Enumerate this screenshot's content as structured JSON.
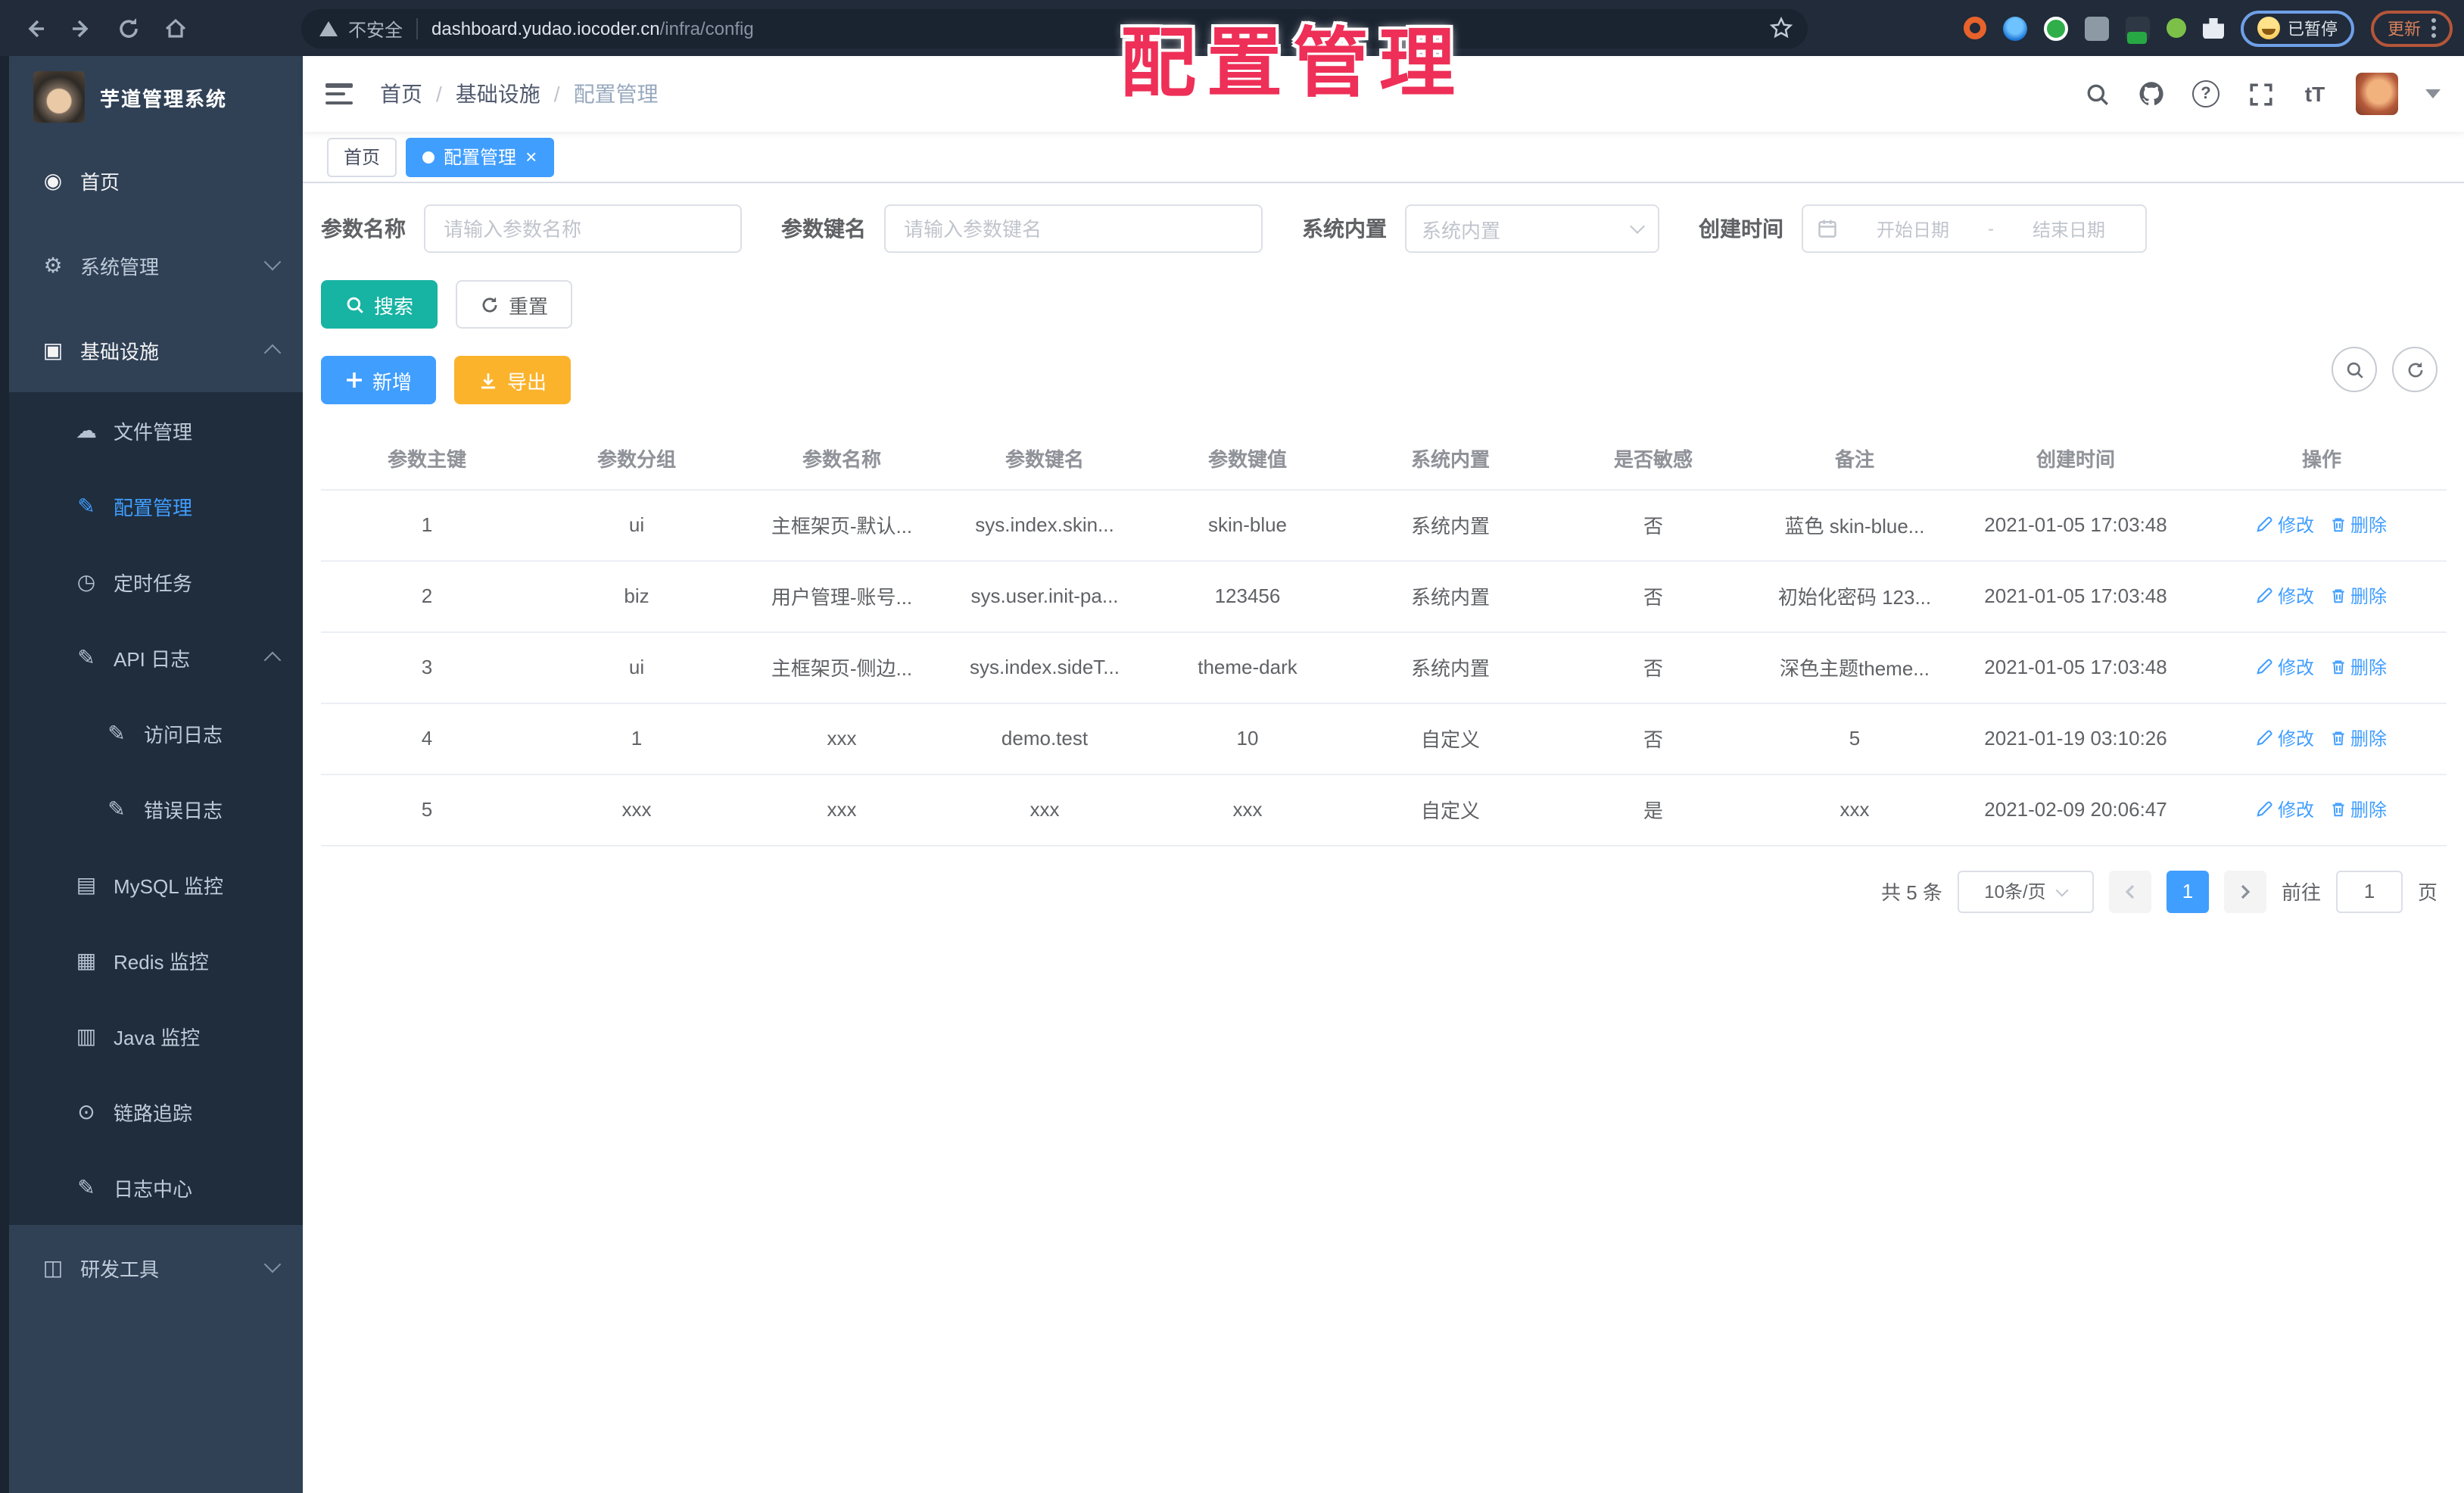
{
  "colors": {
    "accent": "#409eff",
    "search_btn": "#17b3a3",
    "export_btn": "#fbb32c",
    "annotation": "#ee2f57",
    "sidebar_bg": "#304156",
    "submenu_bg": "#1f2d3d"
  },
  "annotation": {
    "text": "配置管理"
  },
  "browser": {
    "security_label": "不安全",
    "url_host": "dashboard.yudao.iocoder.cn",
    "url_path": "/infra/config",
    "paused_label": "已暂停",
    "update_label": "更新"
  },
  "sidebar": {
    "app_title": "芋道管理系统",
    "items": [
      {
        "icon": "◉",
        "label": "首页"
      },
      {
        "icon": "⚙",
        "label": "系统管理"
      },
      {
        "icon": "▣",
        "label": "基础设施"
      },
      {
        "icon": "☁",
        "label": "文件管理"
      },
      {
        "icon": "✎",
        "label": "配置管理"
      },
      {
        "icon": "◷",
        "label": "定时任务"
      },
      {
        "icon": "✎",
        "label": "API 日志"
      },
      {
        "icon": "✎",
        "label": "访问日志"
      },
      {
        "icon": "✎",
        "label": "错误日志"
      },
      {
        "icon": "▤",
        "label": "MySQL 监控"
      },
      {
        "icon": "▦",
        "label": "Redis 监控"
      },
      {
        "icon": "▥",
        "label": "Java 监控"
      },
      {
        "icon": "⊙",
        "label": "链路追踪"
      },
      {
        "icon": "✎",
        "label": "日志中心"
      },
      {
        "icon": "◫",
        "label": "研发工具"
      }
    ]
  },
  "header": {
    "breadcrumb": [
      "首页",
      "基础设施",
      "配置管理"
    ],
    "separator": "/"
  },
  "icons": {
    "question_mark": "?",
    "font_size": "tT",
    "close": "×"
  },
  "tabs": [
    {
      "label": "首页"
    },
    {
      "label": "配置管理"
    }
  ],
  "filters": {
    "name_label": "参数名称",
    "name_placeholder": "请输入参数名称",
    "key_label": "参数键名",
    "key_placeholder": "请输入参数键名",
    "type_label": "系统内置",
    "type_placeholder": "系统内置",
    "date_label": "创建时间",
    "date_start_placeholder": "开始日期",
    "date_separator": "-",
    "date_end_placeholder": "结束日期"
  },
  "actions": {
    "search": "搜索",
    "reset": "重置",
    "add": "新增",
    "export": "导出"
  },
  "table": {
    "columns": [
      "参数主键",
      "参数分组",
      "参数名称",
      "参数键名",
      "参数键值",
      "系统内置",
      "是否敏感",
      "备注",
      "创建时间",
      "操作"
    ],
    "edit_label": "修改",
    "delete_label": "删除",
    "rows": [
      {
        "id": "1",
        "group": "ui",
        "name": "主框架页-默认...",
        "key": "sys.index.skin...",
        "value": "skin-blue",
        "builtin": "系统内置",
        "sensitive": "否",
        "remark": "蓝色 skin-blue...",
        "created": "2021-01-05 17:03:48"
      },
      {
        "id": "2",
        "group": "biz",
        "name": "用户管理-账号...",
        "key": "sys.user.init-pa...",
        "value": "123456",
        "builtin": "系统内置",
        "sensitive": "否",
        "remark": "初始化密码 123...",
        "created": "2021-01-05 17:03:48"
      },
      {
        "id": "3",
        "group": "ui",
        "name": "主框架页-侧边...",
        "key": "sys.index.sideT...",
        "value": "theme-dark",
        "builtin": "系统内置",
        "sensitive": "否",
        "remark": "深色主题theme...",
        "created": "2021-01-05 17:03:48"
      },
      {
        "id": "4",
        "group": "1",
        "name": "xxx",
        "key": "demo.test",
        "value": "10",
        "builtin": "自定义",
        "sensitive": "否",
        "remark": "5",
        "created": "2021-01-19 03:10:26"
      },
      {
        "id": "5",
        "group": "xxx",
        "name": "xxx",
        "key": "xxx",
        "value": "xxx",
        "builtin": "自定义",
        "sensitive": "是",
        "remark": "xxx",
        "created": "2021-02-09 20:06:47"
      }
    ]
  },
  "pagination": {
    "total": "共 5 条",
    "page_size": "10条/页",
    "current": "1",
    "goto_label": "前往",
    "goto_value": "1",
    "page_label": "页"
  }
}
